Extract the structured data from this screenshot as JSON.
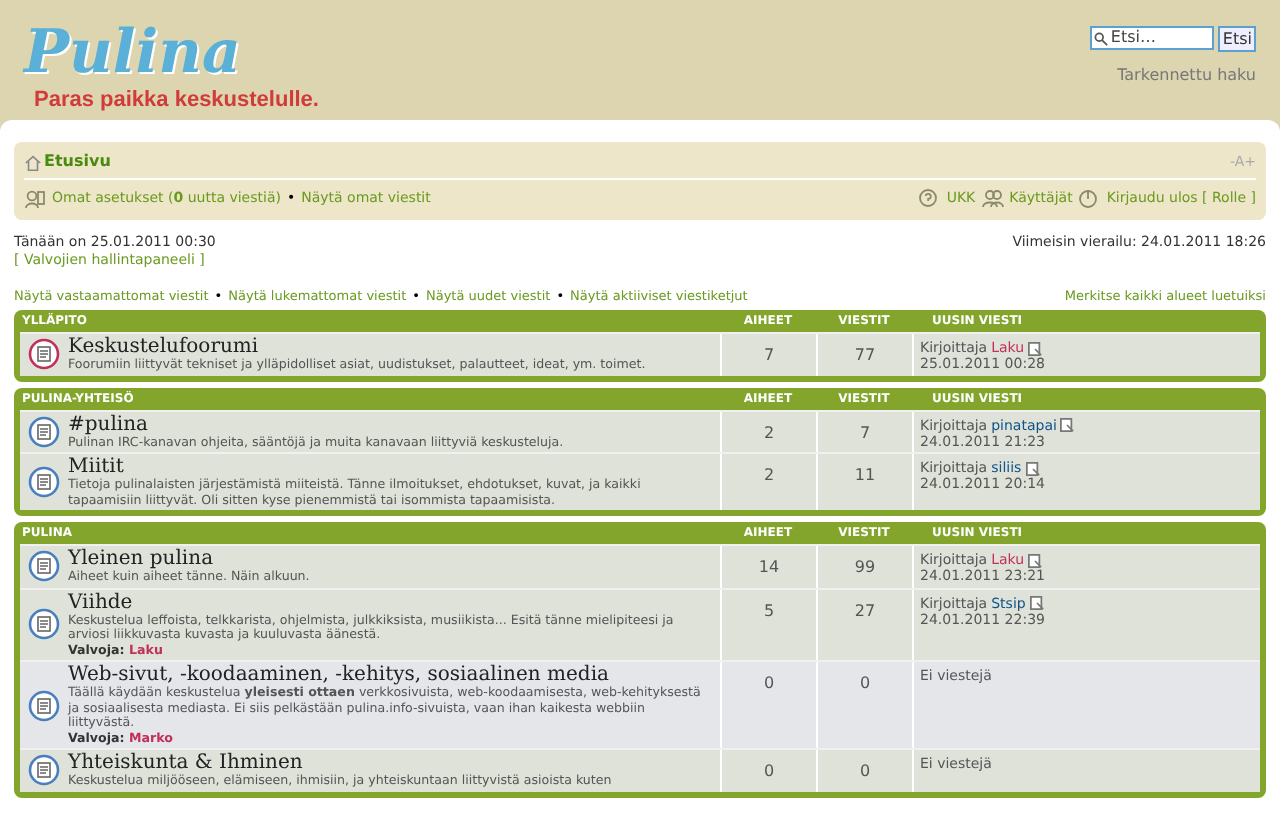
{
  "header": {
    "logo": "Pulina",
    "tagline": "Paras paikka keskustelulle.",
    "search": {
      "placeholder": "Etsi…",
      "button": "Etsi"
    },
    "advanced_search": "Tarkennettu haku"
  },
  "navbar": {
    "breadcrumb": "Etusivu",
    "font_toggle": "-A+",
    "left_links": [
      {
        "kind": "settings",
        "label": "Omat asetukset (**0** uutta viestiä)"
      },
      {
        "kind": "plain",
        "label": "Näytä omat viestit"
      }
    ],
    "right_links": [
      {
        "kind": "faq",
        "label": "UKK"
      },
      {
        "kind": "users",
        "label": "Käyttäjät"
      },
      {
        "kind": "logout",
        "label": "Kirjaudu ulos [ Rolle ]"
      }
    ]
  },
  "separator": "•",
  "info": {
    "today": "Tänään on 25.01.2011 00:30",
    "mcp_link": "[ Valvojien hallintapaneeli ]",
    "last_visit": "Viimeisin vierailu: 24.01.2011 18:26"
  },
  "search_links": [
    "Näytä vastaamattomat viestit",
    "Näytä lukemattomat viestit",
    "Näytä uudet viestit",
    "Näytä aktiiviset viestiketjut"
  ],
  "mark_read": "Merkitse kaikki alueet luetuiksi",
  "categories": [
    {
      "name": "YLLÄPITO",
      "columns": [
        "AIHEET",
        "VIESTIT",
        "UUSIN VIESTI"
      ],
      "forums": [
        {
          "title": "Keskustelufoorumi",
          "unread": true,
          "description": "Foorumiin liittyvät tekniset ja ylläpidolliset asiat, uudistukset, palautteet, ideat, ym. toimet.",
          "topics": "7",
          "posts": "77",
          "last_post": {
            "by": "Kirjoittaja",
            "author": "Laku",
            "color": "#c0305a",
            "time": "25.01.2011 00:28"
          }
        }
      ]
    },
    {
      "name": "PULINA-YHTEISÖ",
      "columns": [
        "AIHEET",
        "VIESTIT",
        "UUSIN VIESTI"
      ],
      "forums": [
        {
          "title": "#pulina",
          "unread": false,
          "description": "Pulinan IRC-kanavan ohjeita, sääntöjä ja muita kanavaan liittyviä keskusteluja.",
          "topics": "2",
          "posts": "7",
          "last_post": {
            "by": "Kirjoittaja",
            "author": "pinatapai",
            "color": "#105289",
            "time": "24.01.2011 21:23"
          }
        },
        {
          "title": "Miitit",
          "unread": false,
          "description": "Tietoja pulinalaisten järjestämistä miiteistä. Tänne ilmoitukset, ehdotukset, kuvat, ja kaikki tapaamisiin liittyvät. Oli sitten kyse pienemmistä tai isommista tapaamisista.",
          "topics": "2",
          "posts": "11",
          "last_post": {
            "by": "Kirjoittaja",
            "author": "siliis",
            "color": "#105289",
            "time": "24.01.2011 20:14"
          }
        }
      ]
    },
    {
      "name": "PULINA",
      "columns": [
        "AIHEET",
        "VIESTIT",
        "UUSIN VIESTI"
      ],
      "forums": [
        {
          "title": "Yleinen pulina",
          "unread": false,
          "description": "Aiheet kuin aiheet tänne. Näin alkuun.",
          "topics": "14",
          "posts": "99",
          "last_post": {
            "by": "Kirjoittaja",
            "author": "Laku",
            "color": "#c0305a",
            "time": "24.01.2011 23:21"
          }
        },
        {
          "title": "Viihde",
          "unread": false,
          "description": "Keskustelua leffoista, telkkarista, ohjelmista, julkkiksista, musiikista... Esitä tänne mielipiteesi ja arviosi liikkuvasta kuvasta ja kuuluvasta äänestä.",
          "moderator": {
            "label": "Valvoja:",
            "name": "Laku"
          },
          "topics": "5",
          "posts": "27",
          "last_post": {
            "by": "Kirjoittaja",
            "author": "Stsip",
            "color": "#105289",
            "time": "24.01.2011 22:39"
          }
        },
        {
          "title": "Web-sivut, -koodaaminen, -kehitys, sosiaalinen media",
          "unread": false,
          "description": "Täällä käydään keskustelua **yleisesti ottaen** verkkosivuista, web-koodaamisesta, web-kehityksestä ja sosiaalisesta mediasta. Ei siis pelkästään pulina.info-sivuista, vaan ihan kaikesta webbiin liittyvästä.",
          "moderator": {
            "label": "Valvoja:",
            "name": "Marko"
          },
          "topics": "0",
          "posts": "0",
          "no_posts": "Ei viestejä"
        },
        {
          "title": "Yhteiskunta & Ihminen",
          "unread": false,
          "description": "Keskustelua miljööseen, elämiseen, ihmisiin, ja yhteiskuntaan liittyvistä asioista kuten",
          "topics": "0",
          "posts": "0",
          "no_posts": "Ei viestejä"
        }
      ]
    }
  ]
}
